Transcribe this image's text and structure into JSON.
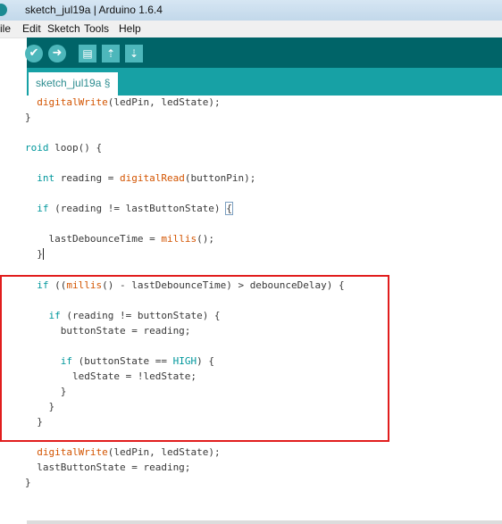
{
  "window": {
    "title": "sketch_jul19a | Arduino 1.6.4"
  },
  "menu": {
    "items": [
      "ile",
      "Edit",
      "Sketch",
      "Tools",
      "Help"
    ]
  },
  "toolbar": {
    "verify_icon": "✔",
    "upload_icon": "➜",
    "new_icon": "▤",
    "open_icon": "⇡",
    "save_icon": "⇣"
  },
  "tabs": {
    "active": "sketch_jul19a §"
  },
  "code": {
    "l1_indent": "  ",
    "l1_fn": "digitalWrite",
    "l1_rest": "(ledPin, ledState);",
    "l2": "}",
    "l3_kw": "roid",
    "l3_rest": " loop() {",
    "l4_indent": "  ",
    "l4_kw": "int",
    "l4_mid": " reading = ",
    "l4_fn": "digitalRead",
    "l4_rest": "(buttonPin);",
    "l5_indent": "  ",
    "l5_kw": "if",
    "l5_rest": " (reading != lastButtonState) ",
    "l5_brace": "{",
    "l6_pre": "    lastDebounceTime = ",
    "l6_fn": "millis",
    "l6_rest": "();",
    "l7_pre": "  ",
    "l7_brace": "}",
    "l8_indent": "  ",
    "l8_kw": "if",
    "l8_open": " ((",
    "l8_fn": "millis",
    "l8_rest": "() - lastDebounceTime) > debounceDelay) {",
    "l9_indent": "    ",
    "l9_kw": "if",
    "l9_rest": " (reading != buttonState) {",
    "l10": "      buttonState = reading;",
    "l11_indent": "      ",
    "l11_kw": "if",
    "l11_mid": " (buttonState == ",
    "l11_const": "HIGH",
    "l11_rest": ") {",
    "l12": "        ledState = !ledState;",
    "l13": "      }",
    "l14": "    }",
    "l15": "  }",
    "l16_indent": "  ",
    "l16_fn": "digitalWrite",
    "l16_rest": "(ledPin, ledState);",
    "l17": "  lastButtonState = reading;",
    "l18": "}"
  },
  "colors": {
    "toolbar": "#006468",
    "tabbar": "#17a1a5",
    "keyword": "#00979c",
    "function": "#d35400",
    "highlight_box": "#e11d1d"
  }
}
